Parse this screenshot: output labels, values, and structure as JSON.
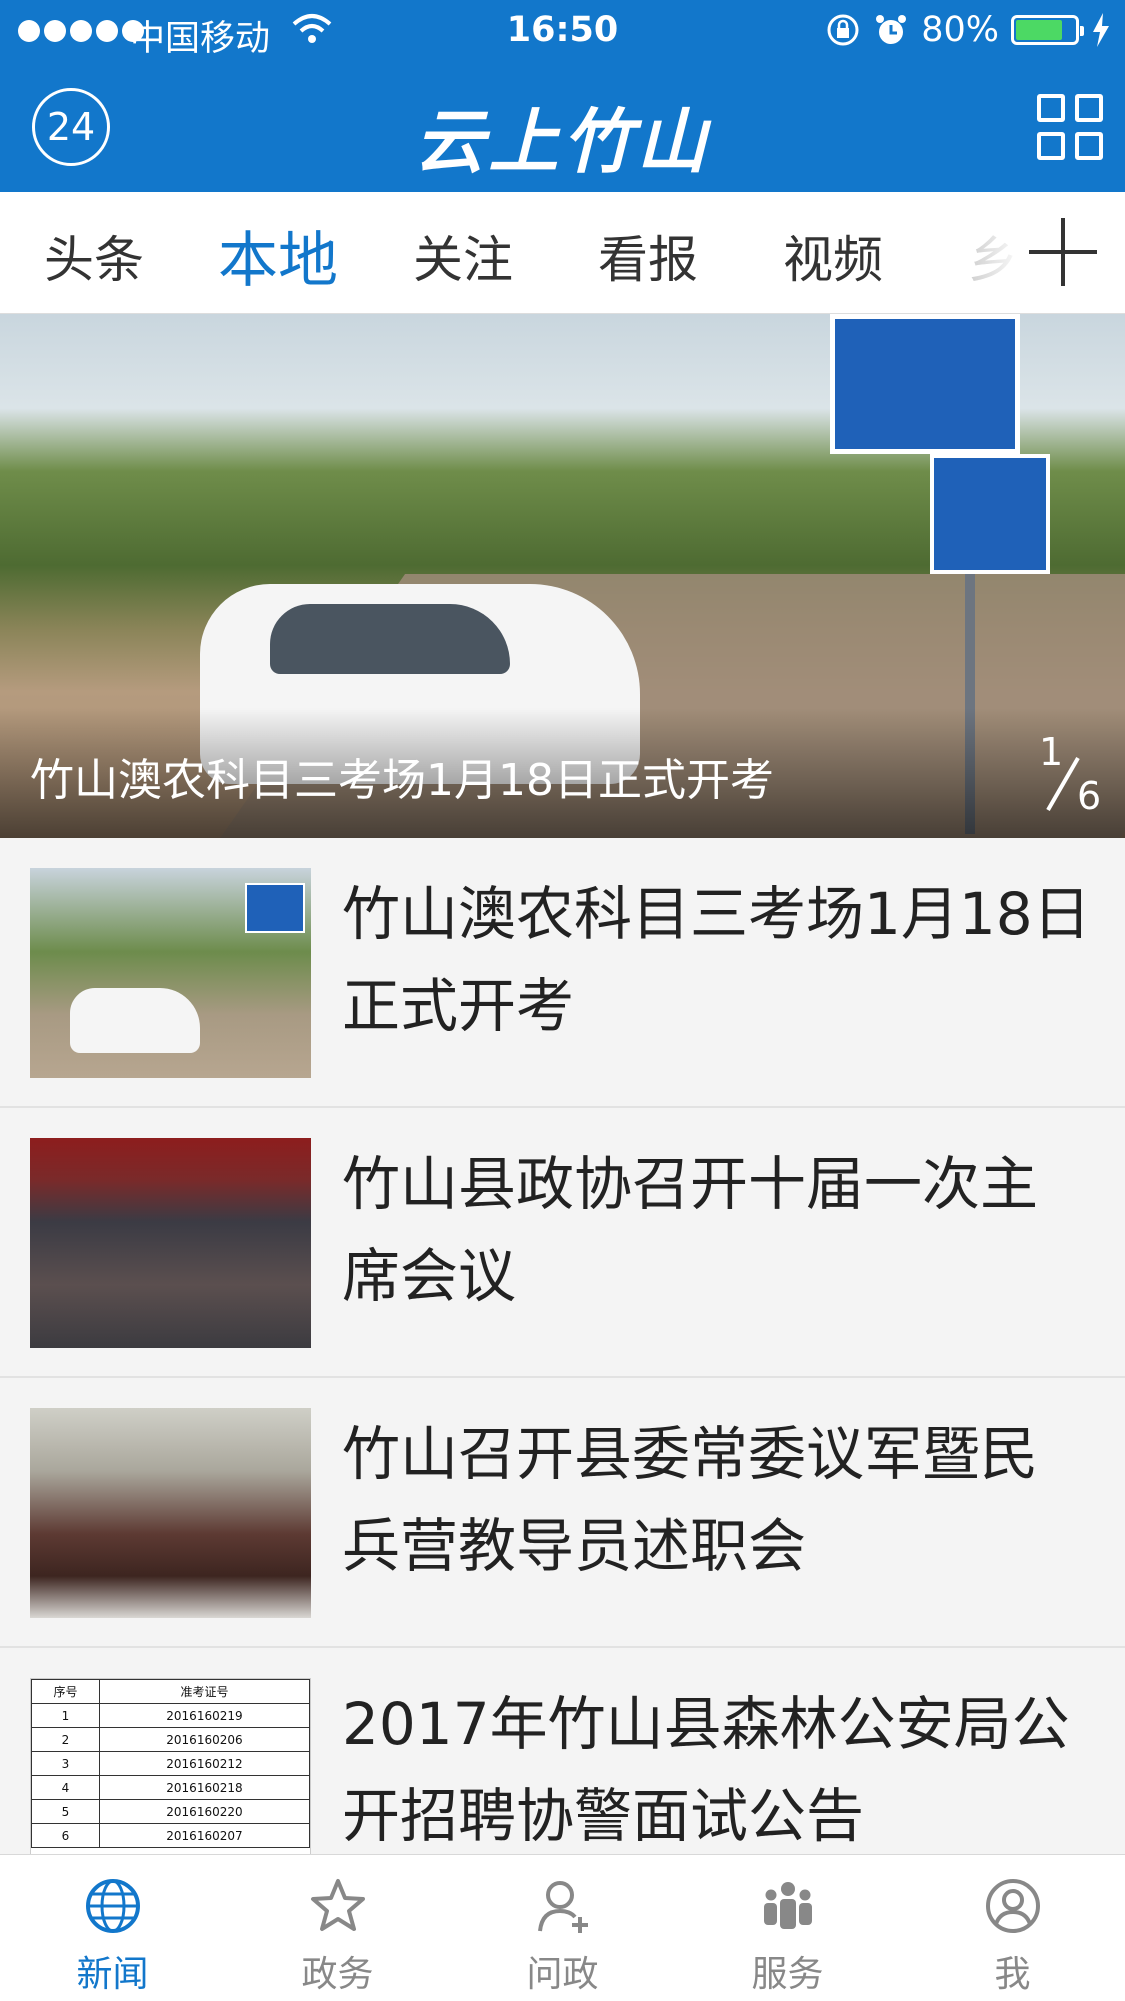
{
  "status_bar": {
    "carrier": "中国移动",
    "time": "16:50",
    "battery_percent": "80%",
    "battery_level": 0.8,
    "battery_fill_color": "#4cd964"
  },
  "header": {
    "left_badge": "24",
    "logo_text": "云上竹山",
    "accent_color": "#1277cb"
  },
  "tabs": {
    "items": [
      {
        "label": "头条"
      },
      {
        "label": "本地",
        "active": true
      },
      {
        "label": "关注"
      },
      {
        "label": "看报"
      },
      {
        "label": "视频"
      },
      {
        "label": "乡"
      }
    ]
  },
  "hero": {
    "caption": "竹山澳农科目三考场1月18日正式开考",
    "page_current": "1",
    "page_total": "6"
  },
  "news": [
    {
      "title": "竹山澳农科目三考场1月18日正式开考"
    },
    {
      "title": "竹山县政协召开十届一次主席会议"
    },
    {
      "title": "竹山召开县委常委议军暨民兵营教导员述职会"
    },
    {
      "title": "2017年竹山县森林公安局公开招聘协警面试公告",
      "thumb_table": {
        "headers": [
          "序号",
          "准考证号"
        ],
        "rows": [
          [
            "1",
            "2016160219"
          ],
          [
            "2",
            "2016160206"
          ],
          [
            "3",
            "2016160212"
          ],
          [
            "4",
            "2016160218"
          ],
          [
            "5",
            "2016160220"
          ],
          [
            "6",
            "2016160207"
          ]
        ]
      }
    }
  ],
  "bottom_nav": {
    "items": [
      {
        "label": "新闻",
        "icon": "globe-icon",
        "active": true
      },
      {
        "label": "政务",
        "icon": "star-icon"
      },
      {
        "label": "问政",
        "icon": "person-add-icon"
      },
      {
        "label": "服务",
        "icon": "group-icon"
      },
      {
        "label": "我",
        "icon": "user-circle-icon"
      }
    ]
  }
}
